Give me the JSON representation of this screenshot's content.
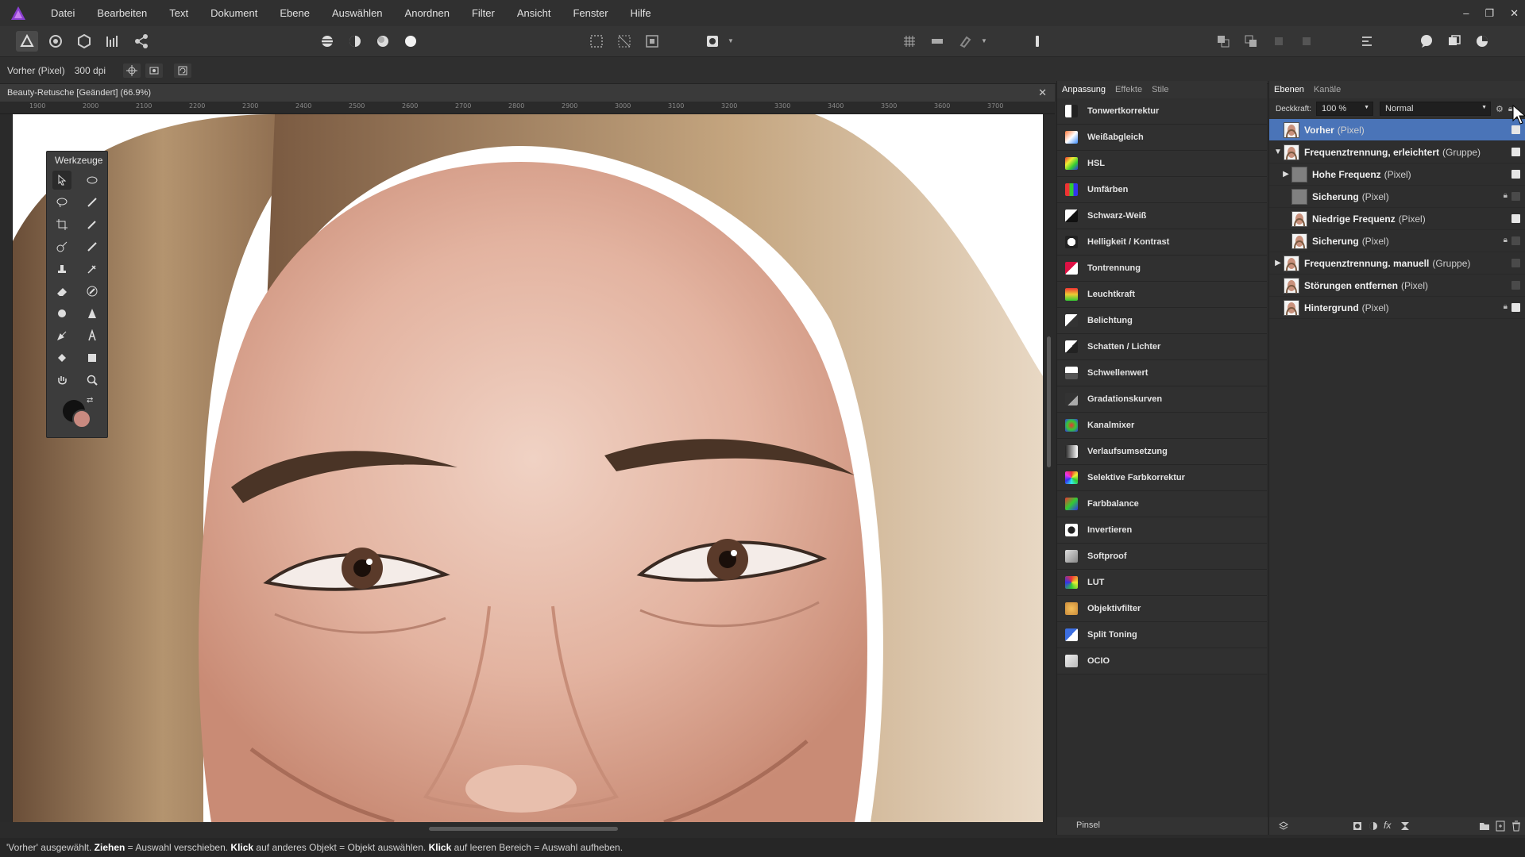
{
  "menu": [
    "Datei",
    "Bearbeiten",
    "Text",
    "Dokument",
    "Ebene",
    "Auswählen",
    "Anordnen",
    "Filter",
    "Ansicht",
    "Fenster",
    "Hilfe"
  ],
  "window_controls": {
    "minimize": "–",
    "restore": "❐",
    "close": "✕"
  },
  "context": {
    "layer_name": "Vorher (Pixel)",
    "dpi": "300 dpi"
  },
  "document": {
    "title": "Beauty-Retusche [Geändert] (66.9%)",
    "close": "✕"
  },
  "ruler_ticks": [
    "1900",
    "2000",
    "2100",
    "2200",
    "2300",
    "2400",
    "2500",
    "2600",
    "2700",
    "2800",
    "2900",
    "3000",
    "3100",
    "3200",
    "3300",
    "3400",
    "3500",
    "3600",
    "3700"
  ],
  "tools_panel": {
    "title": "Werkzeuge"
  },
  "adjust_panel": {
    "tabs": [
      "Anpassung",
      "Effekte",
      "Stile"
    ],
    "items": [
      {
        "label": "Tonwertkorrektur",
        "icon": "levels-icon"
      },
      {
        "label": "Weißabgleich",
        "icon": "white-balance-icon"
      },
      {
        "label": "HSL",
        "icon": "hsl-icon"
      },
      {
        "label": "Umfärben",
        "icon": "recolor-icon"
      },
      {
        "label": "Schwarz-Weiß",
        "icon": "black-white-icon"
      },
      {
        "label": "Helligkeit / Kontrast",
        "icon": "brightness-contrast-icon"
      },
      {
        "label": "Tontrennung",
        "icon": "posterize-icon"
      },
      {
        "label": "Leuchtkraft",
        "icon": "vibrance-icon"
      },
      {
        "label": "Belichtung",
        "icon": "exposure-icon"
      },
      {
        "label": "Schatten / Lichter",
        "icon": "shadows-highlights-icon"
      },
      {
        "label": "Schwellenwert",
        "icon": "threshold-icon"
      },
      {
        "label": "Gradationskurven",
        "icon": "curves-icon"
      },
      {
        "label": "Kanalmixer",
        "icon": "channel-mixer-icon"
      },
      {
        "label": "Verlaufsumsetzung",
        "icon": "gradient-map-icon"
      },
      {
        "label": "Selektive Farbkorrektur",
        "icon": "selective-color-icon"
      },
      {
        "label": "Farbbalance",
        "icon": "color-balance-icon"
      },
      {
        "label": "Invertieren",
        "icon": "invert-icon"
      },
      {
        "label": "Softproof",
        "icon": "softproof-icon"
      },
      {
        "label": "LUT",
        "icon": "lut-icon"
      },
      {
        "label": "Objektivfilter",
        "icon": "lens-filter-icon"
      },
      {
        "label": "Split Toning",
        "icon": "split-toning-icon"
      },
      {
        "label": "OCIO",
        "icon": "ocio-icon"
      }
    ],
    "bottom": "Pinsel"
  },
  "layers_panel": {
    "tabs": [
      "Ebenen",
      "Kanäle"
    ],
    "opacity_label": "Deckkraft:",
    "opacity_value": "100 %",
    "blend_mode": "Normal",
    "layers": [
      {
        "name": "Vorher",
        "type": "(Pixel)",
        "indent": 0,
        "arrow": "",
        "selected": true,
        "checked": true,
        "locked": false
      },
      {
        "name": "Frequenztrennung, erleichtert",
        "type": "(Gruppe)",
        "indent": 0,
        "arrow": "▼",
        "selected": false,
        "checked": true,
        "locked": false
      },
      {
        "name": "Hohe Frequenz",
        "type": "(Pixel)",
        "indent": 1,
        "arrow": "▶",
        "selected": false,
        "checked": true,
        "locked": false
      },
      {
        "name": "Sicherung",
        "type": "(Pixel)",
        "indent": 1,
        "arrow": "",
        "selected": false,
        "checked": false,
        "locked": true
      },
      {
        "name": "Niedrige Frequenz",
        "type": "(Pixel)",
        "indent": 1,
        "arrow": "",
        "selected": false,
        "checked": true,
        "locked": false
      },
      {
        "name": "Sicherung",
        "type": "(Pixel)",
        "indent": 1,
        "arrow": "",
        "selected": false,
        "checked": false,
        "locked": true
      },
      {
        "name": "Frequenztrennung. manuell",
        "type": "(Gruppe)",
        "indent": 0,
        "arrow": "▶",
        "selected": false,
        "checked": false,
        "locked": false
      },
      {
        "name": "Störungen entfernen",
        "type": "(Pixel)",
        "indent": 0,
        "arrow": "",
        "selected": false,
        "checked": false,
        "locked": false
      },
      {
        "name": "Hintergrund",
        "type": "(Pixel)",
        "indent": 0,
        "arrow": "",
        "selected": false,
        "checked": true,
        "locked": true
      }
    ]
  },
  "status": {
    "part1": "'Vorher' ausgewählt. ",
    "b1": "Ziehen",
    "part2": " = Auswahl verschieben. ",
    "b2": "Klick",
    "part3": " auf anderes Objekt = Objekt auswählen. ",
    "b3": "Klick",
    "part4": " auf leeren Bereich = Auswahl aufheben."
  },
  "colors": {
    "accent": "#4a74b8",
    "app": "#7b3fc4",
    "fg_color": "#111111",
    "bg_color": "#c98a80"
  }
}
